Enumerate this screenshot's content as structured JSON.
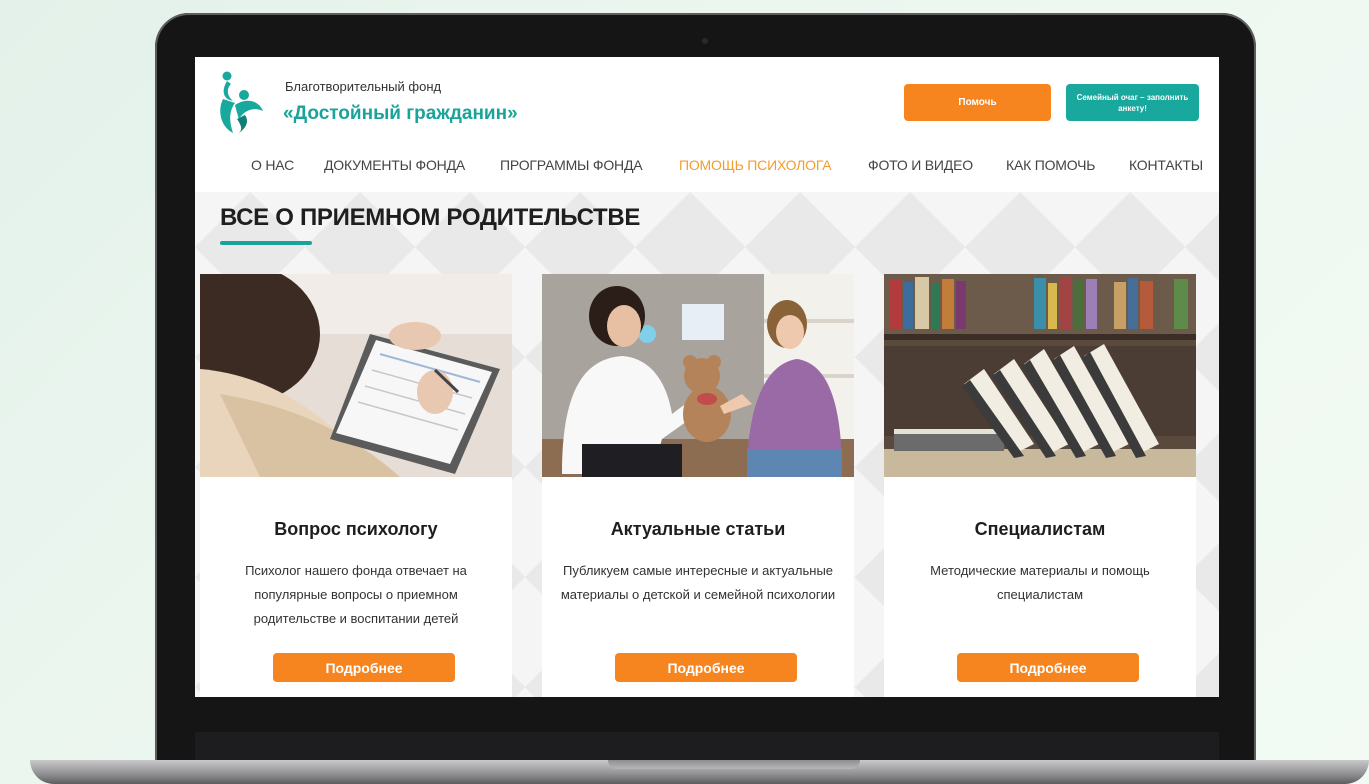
{
  "header": {
    "org_line1": "Благотворительный фонд",
    "org_line2": "«Достойный гражданин»",
    "help_button": "Помочь",
    "family_button": "Семейный очаг – заполнить анкету!"
  },
  "nav": {
    "items": [
      "О НАС",
      "ДОКУМЕНТЫ ФОНДА",
      "ПРОГРАММЫ ФОНДА",
      "ПОМОЩЬ ПСИХОЛОГА",
      "ФОТО И ВИДЕО",
      "КАК ПОМОЧЬ",
      "КОНТАКТЫ"
    ],
    "active": "ПОМОЩЬ ПСИХОЛОГА"
  },
  "section": {
    "title": "ВСЕ О ПРИЕМНОМ РОДИТЕЛЬСТВЕ"
  },
  "cards": [
    {
      "title": "Вопрос психологу",
      "description": "Психолог нашего фонда отвечает на популярные вопросы о приемном родительстве и воспитании детей",
      "button": "Подробнее",
      "image_icon": "psychologist-notes-photo"
    },
    {
      "title": "Актуальные статьи",
      "description": "Публикуем самые интересные и актуальные материалы о детской и семейной психологии",
      "button": "Подробнее",
      "image_icon": "woman-girl-teddy-bear-photo"
    },
    {
      "title": "Специалистам",
      "description": "Методические материалы и помощь специалистам",
      "button": "Подробнее",
      "image_icon": "books-photo"
    }
  ],
  "colors": {
    "accent_orange": "#f7851f",
    "accent_teal": "#18a89d",
    "nav_active": "#f39c31"
  }
}
